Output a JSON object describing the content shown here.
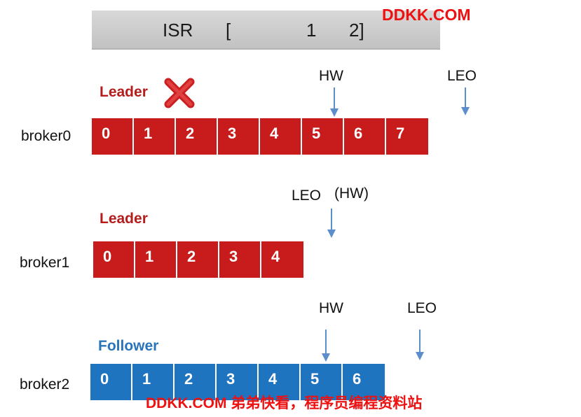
{
  "isr": {
    "label": "ISR",
    "open_bracket": "[",
    "member_1": "1",
    "member_2": "2]"
  },
  "watermark": {
    "top": "DDKK.COM",
    "bottom": "DDKK.COM 弟弟快看，程序员编程资料站"
  },
  "brokers": [
    {
      "name": "broker0",
      "role": "Leader",
      "failed": true,
      "offsets": [
        "0",
        "1",
        "2",
        "3",
        "4",
        "5",
        "6",
        "7"
      ],
      "markers": [
        {
          "label": "HW"
        },
        {
          "label": "LEO"
        }
      ]
    },
    {
      "name": "broker1",
      "role": "Leader",
      "failed": false,
      "offsets": [
        "0",
        "1",
        "2",
        "3",
        "4"
      ],
      "markers": [
        {
          "label": "LEO"
        },
        {
          "label": "(HW)"
        }
      ]
    },
    {
      "name": "broker2",
      "role": "Follower",
      "failed": false,
      "offsets": [
        "0",
        "1",
        "2",
        "3",
        "4",
        "5",
        "6"
      ],
      "markers": [
        {
          "label": "HW"
        },
        {
          "label": "LEO"
        }
      ]
    }
  ],
  "colors": {
    "leader_cell": "#c81b1b",
    "follower_cell": "#1f74c0",
    "leader_text": "#b51d1d",
    "follower_text": "#2a74bc",
    "arrow": "#5b8ecb",
    "watermark": "#ee1111"
  },
  "icons": {
    "failed_marker": "x-mark-icon",
    "pointer": "arrow-down-icon"
  }
}
